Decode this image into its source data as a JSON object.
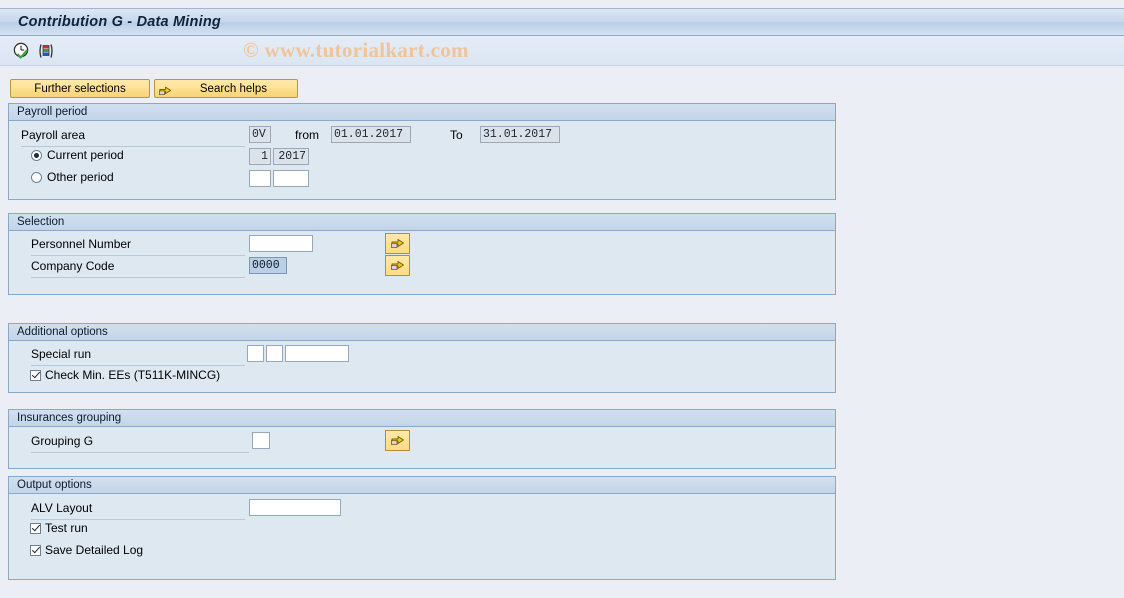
{
  "window": {
    "title": "Contribution G - Data Mining"
  },
  "watermark": "© www.tutorialkart.com",
  "toolbar": {
    "execute_icon": "clock-check-icon",
    "variant_icon": "variant-icon"
  },
  "buttons": {
    "further_selections": "Further selections",
    "search_helps": "Search helps"
  },
  "sections": {
    "payroll_period": {
      "title": "Payroll period",
      "payroll_area_label": "Payroll area",
      "payroll_area_value": "0V",
      "from_label": "from",
      "from_value": "01.01.2017",
      "to_label": "To",
      "to_value": "31.01.2017",
      "current_period_label": "Current period",
      "current_period_selected": true,
      "current_period_value": "1",
      "current_year_value": "2017",
      "other_period_label": "Other period",
      "other_period_selected": false,
      "other_period_value": "",
      "other_year_value": ""
    },
    "selection": {
      "title": "Selection",
      "personnel_number_label": "Personnel Number",
      "personnel_number_value": "",
      "company_code_label": "Company Code",
      "company_code_value": "0000",
      "multi_select_icon": "multiple-selection-arrow-icon"
    },
    "additional_options": {
      "title": "Additional options",
      "special_run_label": "Special run",
      "special_run_value_1": "",
      "special_run_value_2": "",
      "special_run_value_3": "",
      "check_min_ees_label": "Check Min. EEs (T511K-MINCG)",
      "check_min_ees_checked": true
    },
    "insurances_grouping": {
      "title": "Insurances grouping",
      "grouping_g_label": "Grouping G",
      "grouping_g_value": "",
      "multi_select_icon": "multiple-selection-arrow-icon"
    },
    "output_options": {
      "title": "Output options",
      "alv_layout_label": "ALV Layout",
      "alv_layout_value": "",
      "test_run_label": "Test run",
      "test_run_checked": true,
      "save_detailed_log_label": "Save Detailed Log",
      "save_detailed_log_checked": true
    }
  },
  "colors": {
    "title_bar": "#c5d8ec",
    "page_background": "#ebeff5",
    "section_background": "#dde8f1",
    "button_yellow": "#fbdd8a",
    "watermark": "#f0c49a",
    "highlight_field": "#b9cfe6"
  }
}
